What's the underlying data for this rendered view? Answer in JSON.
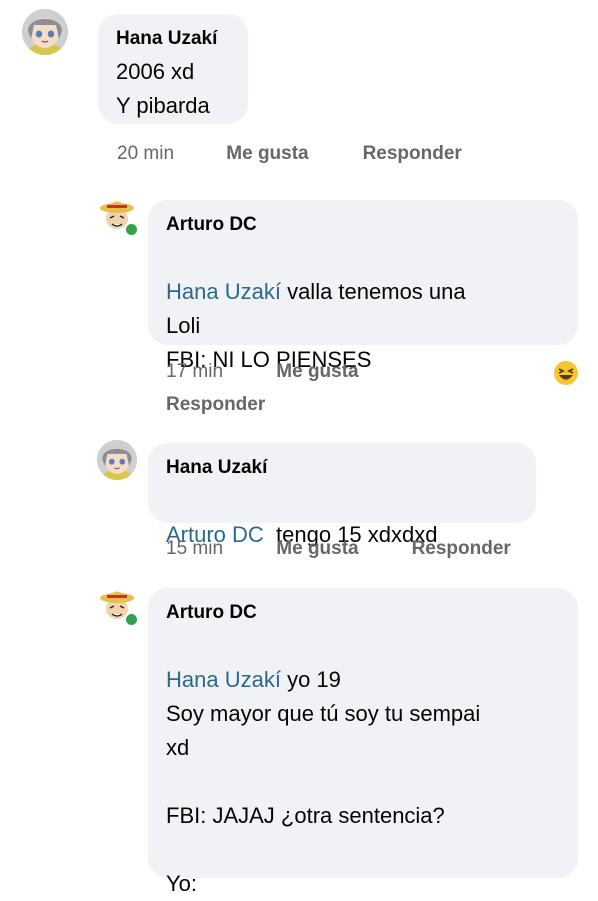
{
  "comments": [
    {
      "author": "Hana Uzakí",
      "text": "2006 xd\nY pibarda",
      "time": "20 min",
      "like": "Me gusta",
      "reply": "Responder"
    },
    {
      "author": "Arturo DC",
      "mention": "Hana Uzakí",
      "text_first": " valla tenemos una",
      "text_rest": "Loli\nFBI: NI LO PIENSES",
      "time": "17 min",
      "like": "Me gusta",
      "reply": "Responder",
      "reaction_icon": "laughing-emoji-icon"
    },
    {
      "author": "Hana Uzakí",
      "mention": "Arturo DC",
      "text_first": "  tengo 15 xdxdxd",
      "time": "15 min",
      "like": "Me gusta",
      "reply": "Responder"
    },
    {
      "author": "Arturo DC",
      "mention": "Hana Uzakí",
      "text_first": " yo 19",
      "text_rest": "Soy mayor que tú soy tu sempai\nxd\n\nFBI: JAJAJ ¿otra sentencia?\n\nYo:"
    }
  ],
  "colors": {
    "bubble": "#f0f2f5",
    "mention": "#2b6a8c",
    "meta": "#65676b",
    "online": "#31a24c"
  }
}
